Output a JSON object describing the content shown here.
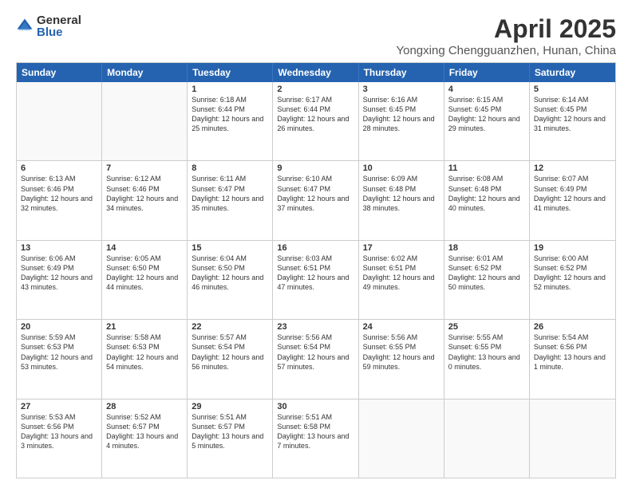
{
  "logo": {
    "general": "General",
    "blue": "Blue"
  },
  "title": "April 2025",
  "subtitle": "Yongxing Chengguanzhen, Hunan, China",
  "header_days": [
    "Sunday",
    "Monday",
    "Tuesday",
    "Wednesday",
    "Thursday",
    "Friday",
    "Saturday"
  ],
  "rows": [
    [
      {
        "day": "",
        "empty": true
      },
      {
        "day": "",
        "empty": true
      },
      {
        "day": "1",
        "text": "Sunrise: 6:18 AM\nSunset: 6:44 PM\nDaylight: 12 hours and 25 minutes."
      },
      {
        "day": "2",
        "text": "Sunrise: 6:17 AM\nSunset: 6:44 PM\nDaylight: 12 hours and 26 minutes."
      },
      {
        "day": "3",
        "text": "Sunrise: 6:16 AM\nSunset: 6:45 PM\nDaylight: 12 hours and 28 minutes."
      },
      {
        "day": "4",
        "text": "Sunrise: 6:15 AM\nSunset: 6:45 PM\nDaylight: 12 hours and 29 minutes."
      },
      {
        "day": "5",
        "text": "Sunrise: 6:14 AM\nSunset: 6:45 PM\nDaylight: 12 hours and 31 minutes."
      }
    ],
    [
      {
        "day": "6",
        "text": "Sunrise: 6:13 AM\nSunset: 6:46 PM\nDaylight: 12 hours and 32 minutes."
      },
      {
        "day": "7",
        "text": "Sunrise: 6:12 AM\nSunset: 6:46 PM\nDaylight: 12 hours and 34 minutes."
      },
      {
        "day": "8",
        "text": "Sunrise: 6:11 AM\nSunset: 6:47 PM\nDaylight: 12 hours and 35 minutes."
      },
      {
        "day": "9",
        "text": "Sunrise: 6:10 AM\nSunset: 6:47 PM\nDaylight: 12 hours and 37 minutes."
      },
      {
        "day": "10",
        "text": "Sunrise: 6:09 AM\nSunset: 6:48 PM\nDaylight: 12 hours and 38 minutes."
      },
      {
        "day": "11",
        "text": "Sunrise: 6:08 AM\nSunset: 6:48 PM\nDaylight: 12 hours and 40 minutes."
      },
      {
        "day": "12",
        "text": "Sunrise: 6:07 AM\nSunset: 6:49 PM\nDaylight: 12 hours and 41 minutes."
      }
    ],
    [
      {
        "day": "13",
        "text": "Sunrise: 6:06 AM\nSunset: 6:49 PM\nDaylight: 12 hours and 43 minutes."
      },
      {
        "day": "14",
        "text": "Sunrise: 6:05 AM\nSunset: 6:50 PM\nDaylight: 12 hours and 44 minutes."
      },
      {
        "day": "15",
        "text": "Sunrise: 6:04 AM\nSunset: 6:50 PM\nDaylight: 12 hours and 46 minutes."
      },
      {
        "day": "16",
        "text": "Sunrise: 6:03 AM\nSunset: 6:51 PM\nDaylight: 12 hours and 47 minutes."
      },
      {
        "day": "17",
        "text": "Sunrise: 6:02 AM\nSunset: 6:51 PM\nDaylight: 12 hours and 49 minutes."
      },
      {
        "day": "18",
        "text": "Sunrise: 6:01 AM\nSunset: 6:52 PM\nDaylight: 12 hours and 50 minutes."
      },
      {
        "day": "19",
        "text": "Sunrise: 6:00 AM\nSunset: 6:52 PM\nDaylight: 12 hours and 52 minutes."
      }
    ],
    [
      {
        "day": "20",
        "text": "Sunrise: 5:59 AM\nSunset: 6:53 PM\nDaylight: 12 hours and 53 minutes."
      },
      {
        "day": "21",
        "text": "Sunrise: 5:58 AM\nSunset: 6:53 PM\nDaylight: 12 hours and 54 minutes."
      },
      {
        "day": "22",
        "text": "Sunrise: 5:57 AM\nSunset: 6:54 PM\nDaylight: 12 hours and 56 minutes."
      },
      {
        "day": "23",
        "text": "Sunrise: 5:56 AM\nSunset: 6:54 PM\nDaylight: 12 hours and 57 minutes."
      },
      {
        "day": "24",
        "text": "Sunrise: 5:56 AM\nSunset: 6:55 PM\nDaylight: 12 hours and 59 minutes."
      },
      {
        "day": "25",
        "text": "Sunrise: 5:55 AM\nSunset: 6:55 PM\nDaylight: 13 hours and 0 minutes."
      },
      {
        "day": "26",
        "text": "Sunrise: 5:54 AM\nSunset: 6:56 PM\nDaylight: 13 hours and 1 minute."
      }
    ],
    [
      {
        "day": "27",
        "text": "Sunrise: 5:53 AM\nSunset: 6:56 PM\nDaylight: 13 hours and 3 minutes."
      },
      {
        "day": "28",
        "text": "Sunrise: 5:52 AM\nSunset: 6:57 PM\nDaylight: 13 hours and 4 minutes."
      },
      {
        "day": "29",
        "text": "Sunrise: 5:51 AM\nSunset: 6:57 PM\nDaylight: 13 hours and 5 minutes."
      },
      {
        "day": "30",
        "text": "Sunrise: 5:51 AM\nSunset: 6:58 PM\nDaylight: 13 hours and 7 minutes."
      },
      {
        "day": "",
        "empty": true
      },
      {
        "day": "",
        "empty": true
      },
      {
        "day": "",
        "empty": true
      }
    ]
  ]
}
